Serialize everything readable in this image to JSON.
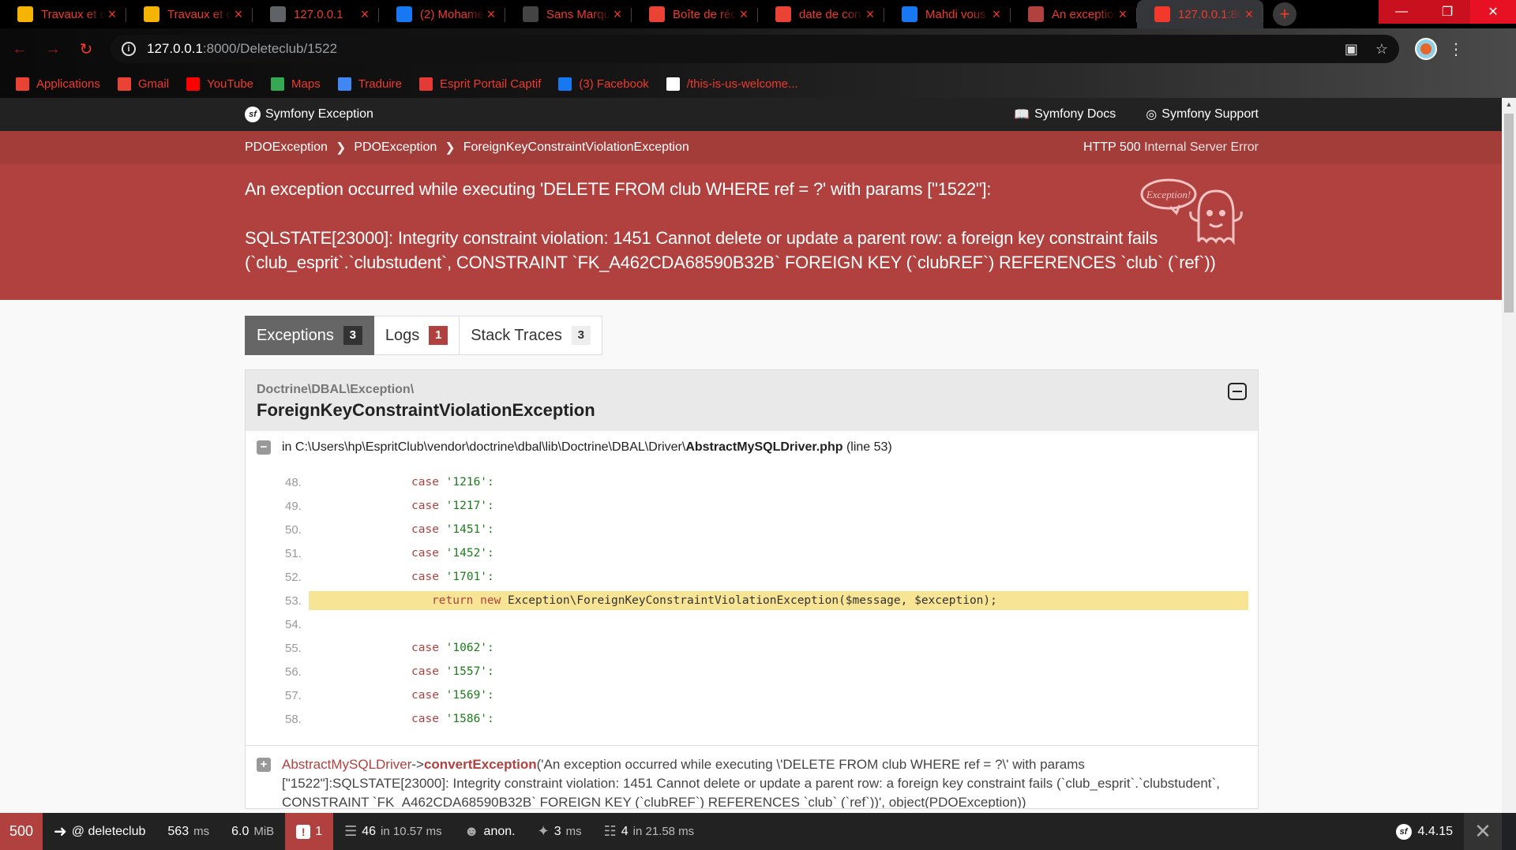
{
  "browser": {
    "tabs": [
      {
        "label": "Travaux et d…",
        "icon": "classroom-icon",
        "color": "#f4b400"
      },
      {
        "label": "Travaux et d…",
        "icon": "classroom-icon",
        "color": "#f4b400"
      },
      {
        "label": "127.0.0.1",
        "icon": "globe-icon",
        "color": "#5f6368"
      },
      {
        "label": "(2) Mohame…",
        "icon": "facebook-icon",
        "color": "#1877f2"
      },
      {
        "label": "Sans Marqu…",
        "icon": "cart-icon",
        "color": "#444444"
      },
      {
        "label": "Boîte de réc…",
        "icon": "gmail-icon",
        "color": "#ea4335"
      },
      {
        "label": "date de con…",
        "icon": "gmail-icon",
        "color": "#ea4335"
      },
      {
        "label": "Mahdi vous…",
        "icon": "facebook-icon",
        "color": "#1877f2"
      },
      {
        "label": "An exception…",
        "icon": "ghost-icon",
        "color": "#b0413e"
      },
      {
        "label": "127.0.0.1:80…",
        "icon": "error-icon",
        "color": "#f2392c"
      }
    ],
    "url_host": "127.0.0.1",
    "url_path": ":8000/Deleteclub/1522",
    "bookmarks": [
      {
        "label": "Applications",
        "icon": "apps-grid-icon",
        "color": "#ea4335"
      },
      {
        "label": "Gmail",
        "icon": "gmail-icon",
        "color": "#ea4335"
      },
      {
        "label": "YouTube",
        "icon": "youtube-icon",
        "color": "#ff0000"
      },
      {
        "label": "Maps",
        "icon": "maps-icon",
        "color": "#34a853"
      },
      {
        "label": "Traduire",
        "icon": "translate-icon",
        "color": "#4285f4"
      },
      {
        "label": "Esprit Portail Captif",
        "icon": "portal-icon",
        "color": "#e53935"
      },
      {
        "label": "(3) Facebook",
        "icon": "facebook-icon",
        "color": "#1877f2"
      },
      {
        "label": "/this-is-us-welcome...",
        "icon": "wordpress-icon",
        "color": "#ffffff"
      }
    ]
  },
  "symfony": {
    "brand": "Symfony Exception",
    "docs": "Symfony Docs",
    "support": "Symfony Support",
    "breadcrumbs": [
      "PDOException",
      "PDOException",
      "ForeignKeyConstraintViolationException"
    ],
    "http_code": "HTTP 500",
    "http_text": "Internal Server Error",
    "message_line1": "An exception occurred while executing 'DELETE FROM club WHERE ref = ?' with params [\"1522\"]:",
    "message_line2": "SQLSTATE[23000]: Integrity constraint violation: 1451 Cannot delete or update a parent row: a foreign key constraint fails (`club_esprit`.`clubstudent`, CONSTRAINT `FK_A462CDA68590B32B` FOREIGN KEY (`clubREF`) REFERENCES `club` (`ref`))",
    "ghost_text": "Exception!",
    "tabs": [
      {
        "label": "Exceptions",
        "count": "3"
      },
      {
        "label": "Logs",
        "count": "1"
      },
      {
        "label": "Stack Traces",
        "count": "3"
      }
    ],
    "trace": {
      "namespace": "Doctrine\\DBAL\\Exception\\",
      "class": "ForeignKeyConstraintViolationException",
      "file_prefix": "in C:\\Users\\hp\\EspritClub\\vendor\\doctrine\\dbal\\lib\\Doctrine\\DBAL\\Driver\\",
      "file_name": "AbstractMySQLDriver.php",
      "file_line": "(line 53)",
      "code": [
        {
          "n": "48.",
          "kw": "case",
          "str": "'1216':"
        },
        {
          "n": "49.",
          "kw": "case",
          "str": "'1217':"
        },
        {
          "n": "50.",
          "kw": "case",
          "str": "'1451':"
        },
        {
          "n": "51.",
          "kw": "case",
          "str": "'1452':"
        },
        {
          "n": "52.",
          "kw": "case",
          "str": "'1701':"
        },
        {
          "n": "53.",
          "kw": "return new",
          "str": "Exception\\ForeignKeyConstraintViolationException($message, $exception);"
        },
        {
          "n": "54.",
          "kw": "",
          "str": ""
        },
        {
          "n": "55.",
          "kw": "case",
          "str": "'1062':"
        },
        {
          "n": "56.",
          "kw": "case",
          "str": "'1557':"
        },
        {
          "n": "57.",
          "kw": "case",
          "str": "'1569':"
        },
        {
          "n": "58.",
          "kw": "case",
          "str": "'1586':"
        }
      ],
      "next_class": "AbstractMySQLDriver",
      "next_arrow": "->",
      "next_fn": "convertException",
      "next_args": "('An exception occurred while executing \\'DELETE FROM club WHERE ref = ?\\' with params [\"1522\"]:SQLSTATE[23000]: Integrity constraint violation: 1451 Cannot delete or update a parent row: a foreign key constraint fails (`club_esprit`.`clubstudent`, CONSTRAINT `FK_A462CDA68590B32B` FOREIGN KEY (`clubREF`) REFERENCES `club` (`ref`))', object(PDOException))"
    }
  },
  "toolbar": {
    "status_code": "500",
    "route": "@ deleteclub",
    "time_value": "563",
    "time_unit": "ms",
    "memory_value": "6.0",
    "memory_unit": "MiB",
    "errors": "1",
    "cache_value": "46",
    "cache_sub": "in 10.57 ms",
    "user": "anon.",
    "twig_value": "3",
    "twig_unit": "ms",
    "db_value": "4",
    "db_sub": "in 21.58 ms",
    "version": "4.4.15"
  },
  "colors": {
    "symfony_red": "#b0413e",
    "highlight_line": "#f7e595",
    "browser_accent": "#f2392c"
  }
}
